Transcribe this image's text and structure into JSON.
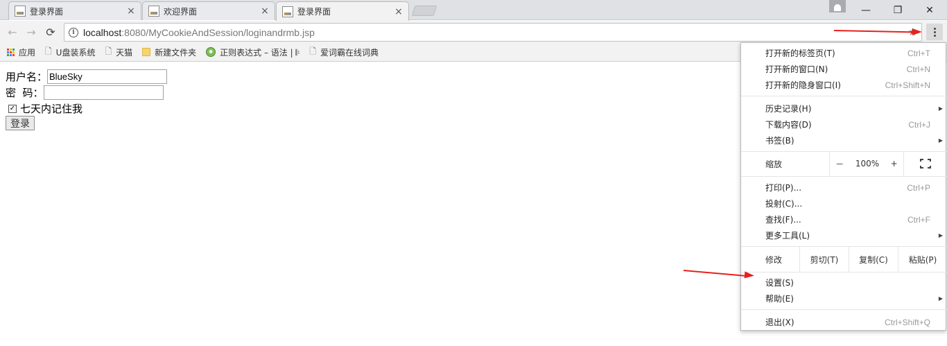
{
  "tabs": [
    {
      "title": "登录界面"
    },
    {
      "title": "欢迎界面"
    },
    {
      "title": "登录界面"
    }
  ],
  "tab_close": "×",
  "window_controls": {
    "minimize": "—",
    "restore": "❐",
    "close": "✕"
  },
  "address": {
    "host": "localhost",
    "rest": ":8080/MyCookieAndSession/loginandrmb.jsp"
  },
  "nav": {
    "back": "←",
    "forward": "→",
    "reload": "⟳",
    "star": "★"
  },
  "bookmarks": [
    {
      "label": "应用",
      "icon": "apps-icon"
    },
    {
      "label": "U盘装系统",
      "icon": "page-icon"
    },
    {
      "label": "天猫",
      "icon": "page-icon"
    },
    {
      "label": "新建文件夹",
      "icon": "folder-icon"
    },
    {
      "label": "正则表达式 – 语法 | 𝄆",
      "icon": "extension-icon"
    },
    {
      "label": "爱词霸在线词典",
      "icon": "page-icon"
    }
  ],
  "form": {
    "username_label": "用户名：",
    "username_value": "BlueSky",
    "password_label": "密  码：",
    "password_value": "",
    "remember_label": "七天内记住我",
    "remember_checked": true,
    "submit_label": "登录"
  },
  "menu": {
    "group1": [
      {
        "label": "打开新的标签页(T)",
        "shortcut": "Ctrl+T"
      },
      {
        "label": "打开新的窗口(N)",
        "shortcut": "Ctrl+N"
      },
      {
        "label": "打开新的隐身窗口(I)",
        "shortcut": "Ctrl+Shift+N"
      }
    ],
    "group2": [
      {
        "label": "历史记录(H)",
        "shortcut": "",
        "submenu": true
      },
      {
        "label": "下载内容(D)",
        "shortcut": "Ctrl+J",
        "submenu": false
      },
      {
        "label": "书签(B)",
        "shortcut": "",
        "submenu": true
      }
    ],
    "zoom": {
      "label": "缩放",
      "minus": "－",
      "value": "100%",
      "plus": "+"
    },
    "group3": [
      {
        "label": "打印(P)...",
        "shortcut": "Ctrl+P",
        "submenu": false
      },
      {
        "label": "投射(C)...",
        "shortcut": "",
        "submenu": false
      },
      {
        "label": "查找(F)...",
        "shortcut": "Ctrl+F",
        "submenu": false
      },
      {
        "label": "更多工具(L)",
        "shortcut": "",
        "submenu": true
      }
    ],
    "edit": {
      "label": "修改",
      "cut": "剪切(T)",
      "copy": "复制(C)",
      "paste": "粘贴(P)"
    },
    "group4": [
      {
        "label": "设置(S)",
        "shortcut": "",
        "submenu": false
      },
      {
        "label": "帮助(E)",
        "shortcut": "",
        "submenu": true
      }
    ],
    "exit": {
      "label": "退出(X)",
      "shortcut": "Ctrl+Shift+Q"
    }
  },
  "colors": {
    "annotation_arrow": "#e8201e"
  }
}
